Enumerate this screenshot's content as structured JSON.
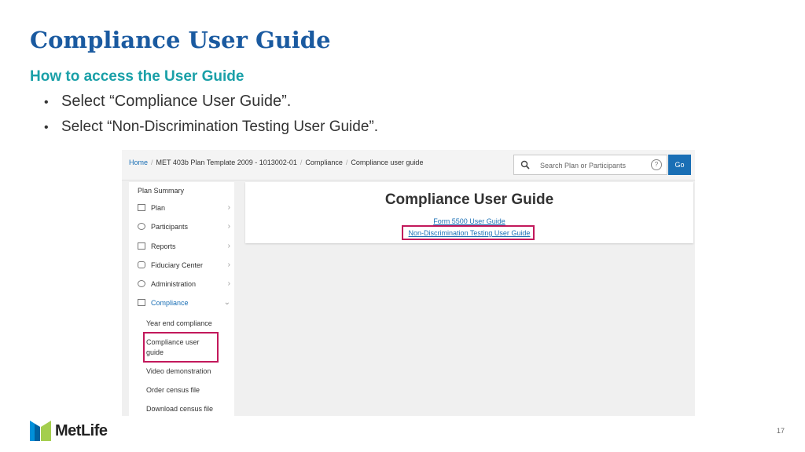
{
  "slide": {
    "title": "Compliance User Guide",
    "subtitle": "How to access the User Guide",
    "bullets": [
      "Select “Compliance User Guide”.",
      "Select “Non-Discrimination Testing User Guide”."
    ],
    "bullet_glyph": "•",
    "page_number": "17",
    "logo_text": "MetLife"
  },
  "breadcrumb": {
    "home": "Home",
    "plan": "MET 403b Plan Template 2009 - 1013002-01",
    "section": "Compliance",
    "current": "Compliance user guide",
    "separator": "/"
  },
  "search": {
    "placeholder": "Search Plan or Participants",
    "help": "?",
    "go_label": "Go"
  },
  "sidebar": {
    "header": "Plan Summary",
    "items": [
      {
        "label": "Plan",
        "icon": "calendar-icon"
      },
      {
        "label": "Participants",
        "icon": "people-icon"
      },
      {
        "label": "Reports",
        "icon": "document-icon"
      },
      {
        "label": "Fiduciary Center",
        "icon": "database-icon"
      },
      {
        "label": "Administration",
        "icon": "info-icon"
      },
      {
        "label": "Compliance",
        "icon": "chart-icon"
      }
    ],
    "chevron": "›",
    "expanded_chevron": "⌄",
    "sub_items": [
      "Year end compliance",
      "Compliance user",
      "guide",
      "Video demonstration",
      "Order census file",
      "Download census file"
    ]
  },
  "main": {
    "title": "Compliance User Guide",
    "links": [
      "Form 5500 User Guide",
      "Non-Discrimination Testing User Guide"
    ]
  },
  "colors": {
    "title": "#1a5aa0",
    "subtitle": "#1aa0a8",
    "highlight": "#c2185b",
    "link": "#1a6fb5",
    "logo_blue": "#0090da",
    "logo_green": "#a4ce4e"
  }
}
